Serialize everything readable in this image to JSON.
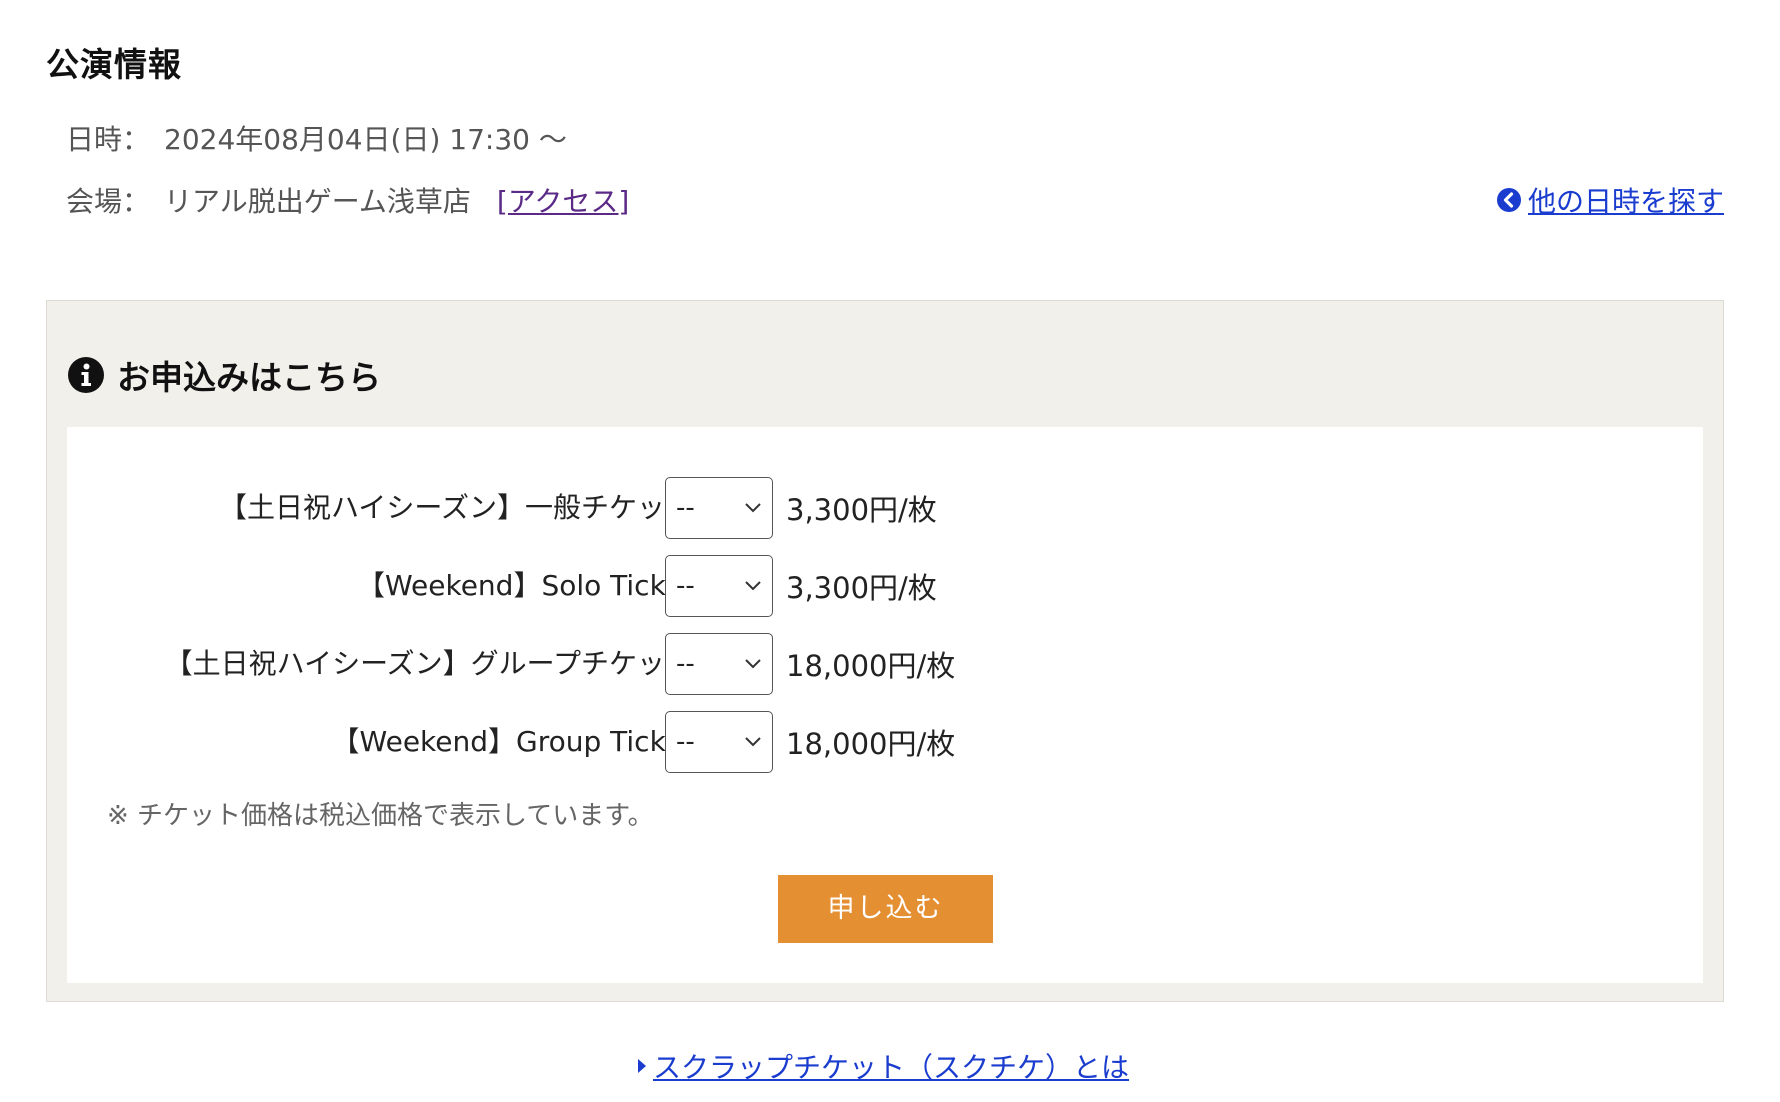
{
  "page": {
    "title": "公演情報"
  },
  "performance": {
    "date_label": "日時：",
    "date_value": "2024年08月04日(日) 17:30 〜",
    "venue_label": "会場：",
    "venue_value": "リアル脱出ゲーム浅草店",
    "access_link": "[アクセス]",
    "other_dates_link": "他の日時を探す",
    "other_dates_icon": "circle-arrow-left-icon"
  },
  "application": {
    "heading": "お申込みはこちら",
    "heading_icon": "info-icon",
    "tickets": [
      {
        "name": "【土日祝ハイシーズン】一般チケット：",
        "selected": "--",
        "price": "3,300円/枚"
      },
      {
        "name": "【Weekend】Solo Ticket：",
        "selected": "--",
        "price": "3,300円/枚"
      },
      {
        "name": "【土日祝ハイシーズン】グループチケット：",
        "selected": "--",
        "price": "18,000円/枚"
      },
      {
        "name": "【Weekend】Group Ticket：",
        "selected": "--",
        "price": "18,000円/枚"
      }
    ],
    "note": "※ チケット価格は税込価格で表示しています。",
    "submit_label": "申し込む"
  },
  "footer": {
    "scrap_link": "スクラップチケット（スクチケ）とは"
  },
  "colors": {
    "accent_button": "#e58f33",
    "link": "#1a3ccf",
    "visited_link": "#5b2a86",
    "panel_bg": "#f1f0ea"
  }
}
